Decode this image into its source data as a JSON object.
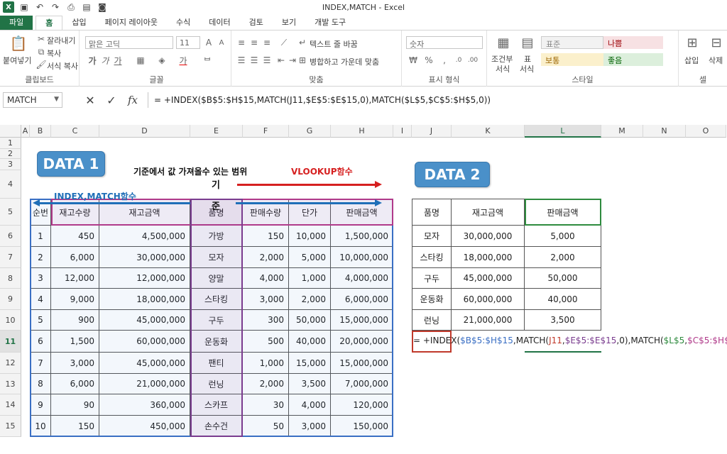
{
  "window": {
    "title": "INDEX,MATCH - Excel"
  },
  "ribbon": {
    "tabs": [
      "파일",
      "홈",
      "삽입",
      "페이지 레이아웃",
      "수식",
      "데이터",
      "검토",
      "보기",
      "개발 도구"
    ],
    "clipboard": {
      "paste": "붙여넣기",
      "cut": "잘라내기",
      "copy": "복사",
      "format_painter": "서식 복사",
      "label": "클립보드"
    },
    "font": {
      "name": "맑은 고딕",
      "size": "11",
      "label": "글꼴"
    },
    "alignment": {
      "wrap_text": "텍스트 줄 바꿈",
      "merge_center": "병합하고 가운데 맞춤",
      "label": "맞춤"
    },
    "number": {
      "format": "숫자",
      "label": "표시 형식"
    },
    "styles": {
      "conditional": "조건부",
      "conditional2": "서식",
      "table": "표",
      "table2": "서식",
      "normal": "표준",
      "bad": "나쁨",
      "neutral": "보통",
      "good": "좋음",
      "label": "스타일"
    },
    "cells": {
      "insert": "삽입",
      "delete": "삭제",
      "label": "셀"
    }
  },
  "formula_bar": {
    "name_box": "MATCH",
    "formula": "= +INDEX($B$5:$H$15,MATCH(J11,$E$5:$E$15,0),MATCH($L$5,$C$5:$H$5,0))"
  },
  "columns": [
    "A",
    "B",
    "C",
    "D",
    "E",
    "F",
    "G",
    "H",
    "I",
    "J",
    "K",
    "L",
    "M",
    "N",
    "O"
  ],
  "rows": [
    "1",
    "2",
    "3",
    "4",
    "5",
    "6",
    "7",
    "8",
    "9",
    "10",
    "11",
    "12",
    "13",
    "14",
    "15"
  ],
  "annotations": {
    "data1": "DATA 1",
    "data2": "DATA 2",
    "range_label": "기준에서 값 가져올수 있는 범위",
    "criterion_top": "기",
    "criterion_bottom": "준",
    "vlookup": "VLOOKUP함수",
    "index_match": "INDEX,MATCH함수"
  },
  "table1": {
    "headers": [
      "순번",
      "재고수량",
      "재고금액",
      "품명",
      "판매수량",
      "단가",
      "판매금액"
    ],
    "rows": [
      [
        "1",
        "450",
        "4,500,000",
        "가방",
        "150",
        "10,000",
        "1,500,000"
      ],
      [
        "2",
        "6,000",
        "30,000,000",
        "모자",
        "2,000",
        "5,000",
        "10,000,000"
      ],
      [
        "3",
        "12,000",
        "12,000,000",
        "양말",
        "4,000",
        "1,000",
        "4,000,000"
      ],
      [
        "4",
        "9,000",
        "18,000,000",
        "스타킹",
        "3,000",
        "2,000",
        "6,000,000"
      ],
      [
        "5",
        "900",
        "45,000,000",
        "구두",
        "300",
        "50,000",
        "15,000,000"
      ],
      [
        "6",
        "1,500",
        "60,000,000",
        "운동화",
        "500",
        "40,000",
        "20,000,000"
      ],
      [
        "7",
        "3,000",
        "45,000,000",
        "팬티",
        "1,000",
        "15,000",
        "15,000,000"
      ],
      [
        "8",
        "6,000",
        "21,000,000",
        "런닝",
        "2,000",
        "3,500",
        "7,000,000"
      ],
      [
        "9",
        "90",
        "360,000",
        "스카프",
        "30",
        "4,000",
        "120,000"
      ],
      [
        "10",
        "150",
        "450,000",
        "손수건",
        "50",
        "3,000",
        "150,000"
      ]
    ]
  },
  "table2": {
    "headers": [
      "품명",
      "재고금액",
      "판매금액"
    ],
    "rows": [
      [
        "모자",
        "30,000,000",
        "5,000"
      ],
      [
        "스타킹",
        "18,000,000",
        "2,000"
      ],
      [
        "구두",
        "45,000,000",
        "50,000"
      ],
      [
        "운동화",
        "60,000,000",
        "40,000"
      ],
      [
        "런닝",
        "21,000,000",
        "3,500"
      ]
    ]
  },
  "cell_formula": {
    "parts": [
      "= +INDEX(",
      "$B$5:$H$15",
      ",MATCH(",
      "J11",
      ",",
      "$E$5:$E$15",
      ",0),MATCH(",
      "$L$5",
      ",",
      "$C$5:$H$5",
      ",0))"
    ],
    "colors": [
      "#222222",
      "#3a6fc4",
      "#222222",
      "#c0392b",
      "#222222",
      "#7a3c8f",
      "#222222",
      "#2e8b3e",
      "#222222",
      "#b03a8a",
      "#222222"
    ]
  },
  "colors": {
    "excel_green": "#217346",
    "badge_blue": "#4a90c9",
    "arrow_red": "#d62020",
    "arrow_blue": "#1f6fb8",
    "range_blue": "#3a6fc4",
    "range_purple": "#7a3c8f",
    "range_pink": "#b03a8a",
    "range_green": "#2e8b3e",
    "range_red": "#c0392b"
  }
}
